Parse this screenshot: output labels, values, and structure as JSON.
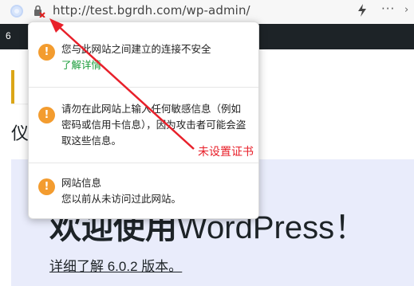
{
  "address_bar": {
    "url": "http://test.bgrdh.com/wp-admin/",
    "more_label": "···",
    "chevron": "›"
  },
  "admin_bar": {
    "count": "6"
  },
  "page": {
    "dashboard_title": "仪",
    "welcome_heading_zh": "欢迎使用",
    "welcome_heading_en": "WordPress！",
    "welcome_link": "详细了解 6.0.2 版本。"
  },
  "popup": {
    "sections": [
      {
        "title": "您与此网站之间建立的连接不安全",
        "link": "了解详情"
      },
      {
        "body": "请勿在此网站上输入任何敏感信息（例如密码或信用卡信息），因为攻击者可能会盗取这些信息。"
      },
      {
        "title": "网站信息",
        "body": "您以前从未访问过此网站。"
      }
    ],
    "warning_glyph": "!"
  },
  "annotation": {
    "label": "未设置证书",
    "color": "#e8202a"
  },
  "colors": {
    "warning": "#f39c2f",
    "link": "#1a9c3a",
    "admin_bar": "#1d2327",
    "welcome_bg": "#e9ecfb"
  },
  "icons": [
    "globe-icon",
    "not-secure-lock-icon",
    "lightning-icon",
    "more-icon",
    "chevron-right-icon",
    "warning-icon"
  ]
}
